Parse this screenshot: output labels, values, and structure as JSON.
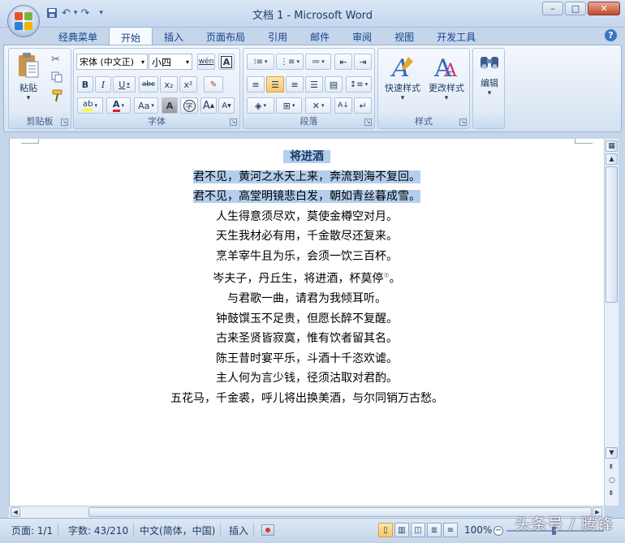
{
  "window": {
    "title": "文档 1 - Microsoft Word",
    "minimize": "–",
    "maximize": "□",
    "close": "✕"
  },
  "qat": {
    "save_icon": "save-icon",
    "undo": "↶",
    "undo_dd": "▾",
    "redo": "↷",
    "customize": "▾"
  },
  "tabs": [
    "经典菜单",
    "开始",
    "插入",
    "页面布局",
    "引用",
    "邮件",
    "审阅",
    "视图",
    "开发工具"
  ],
  "active_tab": "开始",
  "help": "?",
  "ribbon": {
    "clipboard": {
      "label": "剪贴板",
      "paste": "粘贴",
      "paste_arrow": "▾"
    },
    "font": {
      "label": "字体",
      "font_name": "宋体 (中文正)",
      "font_size": "小四",
      "wen": "wén",
      "a_box": "A",
      "bold": "B",
      "italic": "I",
      "underline": "U",
      "strike": "abc",
      "sub": "x₂",
      "sup": "x²",
      "highlight": "ab",
      "color_a": "A",
      "aa": "Aa",
      "a_shade": "A",
      "circle": "字",
      "grow": "A",
      "shrink": "A"
    },
    "paragraph": {
      "label": "段落"
    },
    "styles": {
      "label": "样式",
      "quick": "快速样式",
      "change": "更改样式"
    },
    "editing": {
      "label": "编辑"
    }
  },
  "document": {
    "title": "将进酒",
    "lines": [
      "君不见，黄河之水天上来，奔流到海不复回。",
      "君不见，高堂明镜悲白发，朝如青丝暮成雪。",
      "人生得意须尽欢，莫使金樽空对月。",
      "天生我材必有用，千金散尽还复来。",
      "烹羊宰牛且为乐，会须一饮三百杯。",
      "岑夫子，丹丘生，将进酒，杯莫停",
      "与君歌一曲，请君为我倾耳听。",
      "钟鼓馔玉不足贵，但愿长醉不复醒。",
      "古来圣贤皆寂寞，惟有饮者留其名。",
      "陈王昔时宴平乐，斗酒十千恣欢谑。",
      "主人何为言少钱，径须沽取对君酌。",
      "五花马，千金裘，呼儿将出换美酒，与尔同销万古愁。"
    ],
    "footnote_mark": "⑦",
    "line6_tail": "。"
  },
  "status": {
    "page": "页面: 1/1",
    "words": "字数: 43/210",
    "language": "中文(简体，中国)",
    "mode": "插入",
    "zoom": "100%"
  },
  "watermark": "头条号 / 腾锋"
}
